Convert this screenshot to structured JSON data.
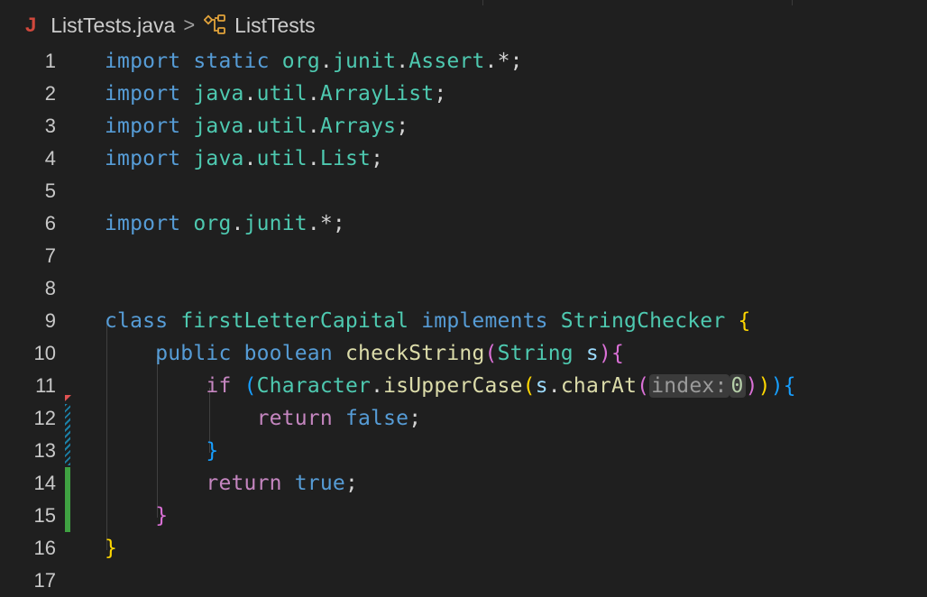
{
  "breadcrumb": {
    "file_icon": "java-file-icon",
    "file_icon_glyph": "J",
    "file_name": "ListTests.java",
    "separator": ">",
    "symbol_icon": "class-symbol-icon",
    "symbol_name": "ListTests"
  },
  "editor": {
    "line_numbers": [
      "1",
      "2",
      "3",
      "4",
      "5",
      "6",
      "7",
      "8",
      "9",
      "10",
      "11",
      "12",
      "13",
      "14",
      "15",
      "16",
      "17"
    ],
    "lines": [
      [
        {
          "t": "import",
          "c": "kw"
        },
        {
          "t": " ",
          "c": "pu"
        },
        {
          "t": "static",
          "c": "kw"
        },
        {
          "t": " ",
          "c": "pu"
        },
        {
          "t": "org",
          "c": "pk"
        },
        {
          "t": ".",
          "c": "pu"
        },
        {
          "t": "junit",
          "c": "pk"
        },
        {
          "t": ".",
          "c": "pu"
        },
        {
          "t": "Assert",
          "c": "pk"
        },
        {
          "t": ".*;",
          "c": "pu"
        }
      ],
      [
        {
          "t": "import",
          "c": "kw"
        },
        {
          "t": " ",
          "c": "pu"
        },
        {
          "t": "java",
          "c": "pk"
        },
        {
          "t": ".",
          "c": "pu"
        },
        {
          "t": "util",
          "c": "pk"
        },
        {
          "t": ".",
          "c": "pu"
        },
        {
          "t": "ArrayList",
          "c": "pk"
        },
        {
          "t": ";",
          "c": "pu"
        }
      ],
      [
        {
          "t": "import",
          "c": "kw"
        },
        {
          "t": " ",
          "c": "pu"
        },
        {
          "t": "java",
          "c": "pk"
        },
        {
          "t": ".",
          "c": "pu"
        },
        {
          "t": "util",
          "c": "pk"
        },
        {
          "t": ".",
          "c": "pu"
        },
        {
          "t": "Arrays",
          "c": "pk"
        },
        {
          "t": ";",
          "c": "pu"
        }
      ],
      [
        {
          "t": "import",
          "c": "kw"
        },
        {
          "t": " ",
          "c": "pu"
        },
        {
          "t": "java",
          "c": "pk"
        },
        {
          "t": ".",
          "c": "pu"
        },
        {
          "t": "util",
          "c": "pk"
        },
        {
          "t": ".",
          "c": "pu"
        },
        {
          "t": "List",
          "c": "pk"
        },
        {
          "t": ";",
          "c": "pu"
        }
      ],
      [],
      [
        {
          "t": "import",
          "c": "kw"
        },
        {
          "t": " ",
          "c": "pu"
        },
        {
          "t": "org",
          "c": "pk"
        },
        {
          "t": ".",
          "c": "pu"
        },
        {
          "t": "junit",
          "c": "pk"
        },
        {
          "t": ".*;",
          "c": "pu"
        }
      ],
      [],
      [],
      [
        {
          "t": "class",
          "c": "kw"
        },
        {
          "t": " ",
          "c": "pu"
        },
        {
          "t": "firstLetterCapital",
          "c": "ty"
        },
        {
          "t": " ",
          "c": "pu"
        },
        {
          "t": "implements",
          "c": "kw"
        },
        {
          "t": " ",
          "c": "pu"
        },
        {
          "t": "StringChecker",
          "c": "ty"
        },
        {
          "t": " ",
          "c": "pu"
        },
        {
          "t": "{",
          "c": "br1"
        }
      ],
      [
        {
          "t": "    ",
          "c": "pu"
        },
        {
          "t": "public",
          "c": "kw"
        },
        {
          "t": " ",
          "c": "pu"
        },
        {
          "t": "boolean",
          "c": "kw"
        },
        {
          "t": " ",
          "c": "pu"
        },
        {
          "t": "checkString",
          "c": "fn"
        },
        {
          "t": "(",
          "c": "br2"
        },
        {
          "t": "String",
          "c": "ty"
        },
        {
          "t": " ",
          "c": "pu"
        },
        {
          "t": "s",
          "c": "var"
        },
        {
          "t": ")",
          "c": "br2"
        },
        {
          "t": "{",
          "c": "br2"
        }
      ],
      [
        {
          "t": "        ",
          "c": "pu"
        },
        {
          "t": "if",
          "c": "kwc"
        },
        {
          "t": " ",
          "c": "pu"
        },
        {
          "t": "(",
          "c": "br3"
        },
        {
          "t": "Character",
          "c": "ty"
        },
        {
          "t": ".",
          "c": "pu"
        },
        {
          "t": "isUpperCase",
          "c": "fn"
        },
        {
          "t": "(",
          "c": "br1"
        },
        {
          "t": "s",
          "c": "var"
        },
        {
          "t": ".",
          "c": "pu"
        },
        {
          "t": "charAt",
          "c": "fn"
        },
        {
          "t": "(",
          "c": "br2"
        },
        {
          "t": "index:",
          "c": "hint"
        },
        {
          "t": "0",
          "c": "hintval"
        },
        {
          "t": ")",
          "c": "br2"
        },
        {
          "t": ")",
          "c": "br1"
        },
        {
          "t": ")",
          "c": "br3"
        },
        {
          "t": "{",
          "c": "br3"
        }
      ],
      [
        {
          "t": "            ",
          "c": "pu"
        },
        {
          "t": "return",
          "c": "kwc"
        },
        {
          "t": " ",
          "c": "pu"
        },
        {
          "t": "false",
          "c": "kw"
        },
        {
          "t": ";",
          "c": "pu"
        }
      ],
      [
        {
          "t": "        ",
          "c": "pu"
        },
        {
          "t": "}",
          "c": "br3"
        }
      ],
      [
        {
          "t": "        ",
          "c": "pu"
        },
        {
          "t": "return",
          "c": "kwc"
        },
        {
          "t": " ",
          "c": "pu"
        },
        {
          "t": "true",
          "c": "kw"
        },
        {
          "t": ";",
          "c": "pu"
        }
      ],
      [
        {
          "t": "    ",
          "c": "pu"
        },
        {
          "t": "}",
          "c": "br2"
        }
      ],
      [
        {
          "t": "}",
          "c": "br1"
        }
      ],
      []
    ]
  },
  "colors": {
    "background": "#1f1f1f",
    "keyword": "#569cd6",
    "control_keyword": "#c586c0",
    "type": "#4ec9b0",
    "function": "#dcdcaa",
    "variable": "#9cdcfe",
    "added_line": "#3fa142",
    "modified_line": "#1b81a8",
    "deleted_line": "#e05252"
  },
  "gutter": {
    "deleted_marker_line": 11,
    "modified_lines": [
      12,
      13
    ],
    "added_lines": [
      14,
      15
    ]
  }
}
